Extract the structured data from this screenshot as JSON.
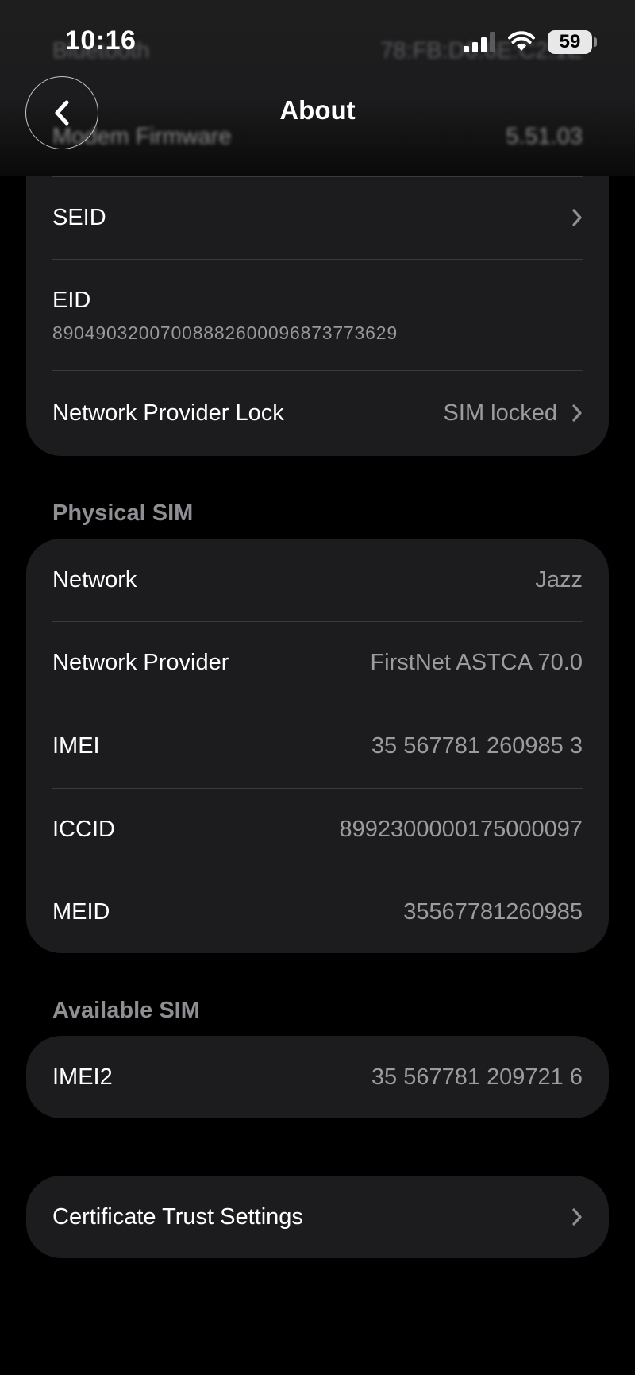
{
  "status_bar": {
    "time": "10:16",
    "battery": "59"
  },
  "nav": {
    "title": "About"
  },
  "behind": {
    "row1_label": "Bluetooth",
    "row1_value": "78:FB:D6:6E:C2:1E",
    "row2_label": "Modem Firmware",
    "row2_value": "5.51.03"
  },
  "group1": {
    "seid_label": "SEID",
    "eid_label": "EID",
    "eid_value": "89049032007008882600096873773629",
    "lock_label": "Network Provider Lock",
    "lock_value": "SIM locked"
  },
  "physical_sim": {
    "header": "Physical SIM",
    "rows": [
      {
        "label": "Network",
        "value": "Jazz"
      },
      {
        "label": "Network Provider",
        "value": "FirstNet ASTCA 70.0"
      },
      {
        "label": "IMEI",
        "value": "35 567781 260985 3"
      },
      {
        "label": "ICCID",
        "value": "8992300000175000097"
      },
      {
        "label": "MEID",
        "value": "35567781260985"
      }
    ]
  },
  "available_sim": {
    "header": "Available SIM",
    "rows": [
      {
        "label": "IMEI2",
        "value": "35 567781 209721 6"
      }
    ]
  },
  "certificate": {
    "label": "Certificate Trust Settings"
  },
  "icons": {
    "back": "chevron-left-icon",
    "disclosure": "chevron-right-icon",
    "signal": "cellular-signal-icon",
    "wifi": "wifi-icon",
    "battery": "battery-icon"
  },
  "colors": {
    "background": "#000000",
    "group": "#1c1c1e",
    "separator": "#3a3a3c",
    "secondary_text": "#9b9ba0",
    "section_header": "#8e8e93"
  }
}
